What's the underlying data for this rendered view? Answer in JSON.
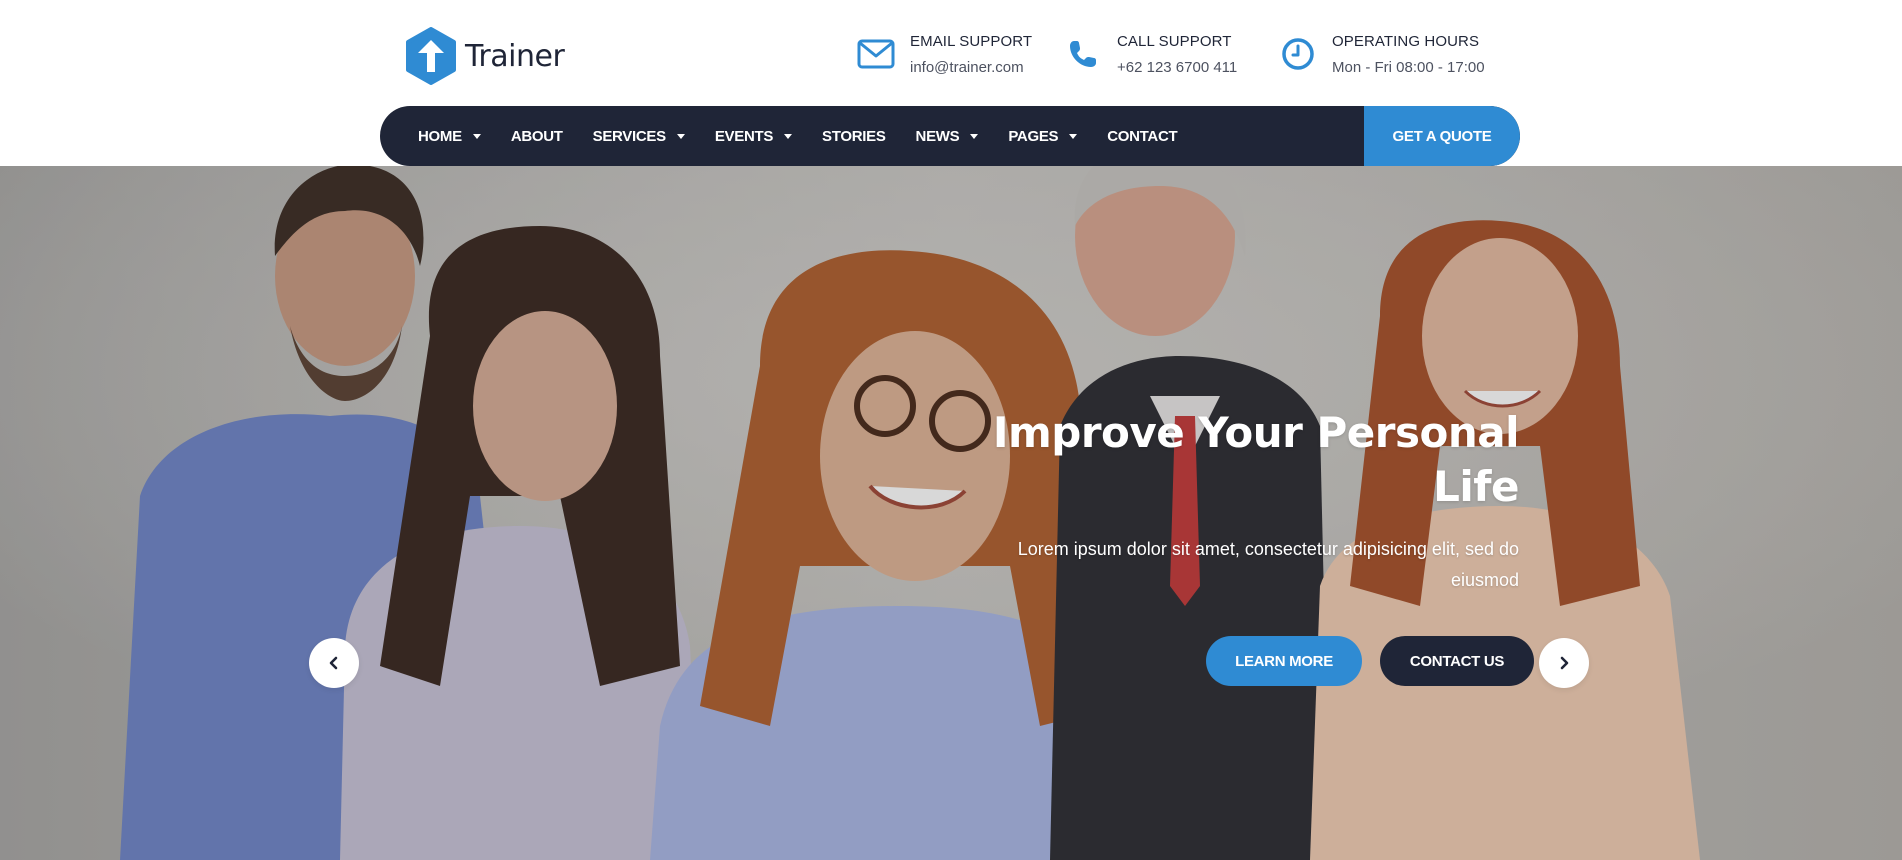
{
  "brand": {
    "name": "Trainer",
    "color": "#2f8bd3",
    "dark": "#1f2537"
  },
  "header": {
    "contacts": [
      {
        "icon": "envelope-icon",
        "title": "EMAIL SUPPORT",
        "value": "info@trainer.com"
      },
      {
        "icon": "phone-icon",
        "title": "CALL SUPPORT",
        "value": "+62 123 6700 411"
      },
      {
        "icon": "clock-icon",
        "title": "OPERATING HOURS",
        "value": "Mon - Fri 08:00 - 17:00"
      }
    ]
  },
  "nav": {
    "items": [
      {
        "label": "HOME",
        "dropdown": true
      },
      {
        "label": "ABOUT",
        "dropdown": false
      },
      {
        "label": "SERVICES",
        "dropdown": true
      },
      {
        "label": "EVENTS",
        "dropdown": true
      },
      {
        "label": "STORIES",
        "dropdown": false
      },
      {
        "label": "NEWS",
        "dropdown": true
      },
      {
        "label": "PAGES",
        "dropdown": true
      },
      {
        "label": "CONTACT",
        "dropdown": false
      }
    ],
    "cta_label": "GET A QUOTE"
  },
  "hero": {
    "title": "Improve Your Personal Life",
    "description": "Lorem ipsum dolor sit amet, consectetur adipisicing elit, sed do eiusmod",
    "primary_button": "LEARN MORE",
    "secondary_button": "CONTACT US",
    "prev_icon": "chevron-left-icon",
    "next_icon": "chevron-right-icon"
  }
}
